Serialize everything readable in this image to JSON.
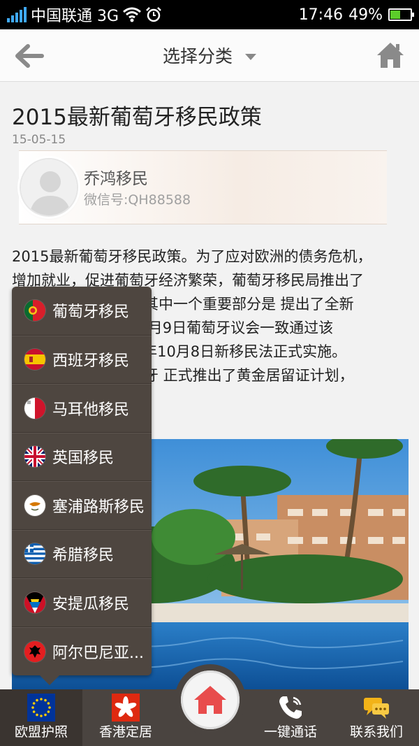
{
  "status_bar": {
    "carrier": "中国联通 3G",
    "time": "17:46",
    "battery": "49%",
    "battery_level": 0.49
  },
  "header": {
    "title": "选择分类"
  },
  "article": {
    "title": "2015最新葡萄牙移民政策",
    "date": "15-05-15",
    "author_name": "乔鸿移民",
    "author_wechat": "微信号:QH88588",
    "paragraph_lines": [
      "2015最新葡萄牙移民政策。为了应对欧洲的债务危机，",
      "增加就业，促进葡萄牙经济繁荣，葡萄牙移民局推出了",
      "　　　　　　　案，其中一个重要部分是 提出了全新",
      "　　　　　　　2年8月9日葡萄牙议会一致通过该",
      "　　　　　　　012年10月8日新移民法正式实施。",
      "　　　　　　　葡萄牙 正式推出了黄金居留证计划，"
    ]
  },
  "menu": {
    "items": [
      {
        "label": "葡萄牙移民",
        "flag": "portugal-flag-icon"
      },
      {
        "label": "西班牙移民",
        "flag": "spain-flag-icon"
      },
      {
        "label": "马耳他移民",
        "flag": "malta-flag-icon"
      },
      {
        "label": "英国移民",
        "flag": "uk-flag-icon"
      },
      {
        "label": "塞浦路斯移民",
        "flag": "cyprus-flag-icon"
      },
      {
        "label": "希腊移民",
        "flag": "greece-flag-icon"
      },
      {
        "label": "安提瓜移民",
        "flag": "antigua-flag-icon"
      },
      {
        "label": "阿尔巴尼亚...",
        "flag": "albania-flag-icon"
      }
    ]
  },
  "bottom_nav": {
    "eu_passport": "欧盟护照",
    "hk_residence": "香港定居",
    "one_click_call": "一键通话",
    "contact_us": "联系我们"
  },
  "colors": {
    "nav_bg": "#4a4440",
    "menu_bg": "#4e4640",
    "home_red": "#e84c4c"
  }
}
